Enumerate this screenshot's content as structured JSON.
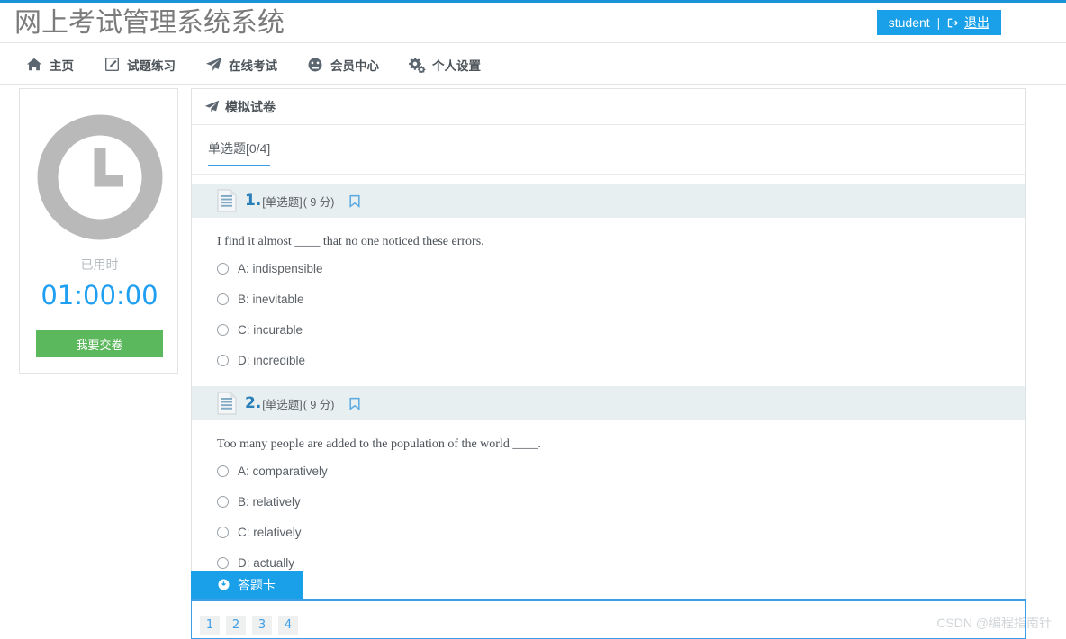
{
  "site": {
    "title": "网上考试管理系统系统",
    "accent_blue": "#19a0e8",
    "accent_green": "#5cb85c",
    "timer_blue": "#1e9ff2"
  },
  "user": {
    "name": "student",
    "separator": "|",
    "logout_label": "退出",
    "logout_icon": "sign-out-icon"
  },
  "nav": {
    "items": [
      {
        "label": "主页",
        "icon": "home-icon"
      },
      {
        "label": "试题练习",
        "icon": "pencil-square-icon"
      },
      {
        "label": "在线考试",
        "icon": "paper-plane-icon"
      },
      {
        "label": "会员中心",
        "icon": "dashboard-gauge-icon"
      },
      {
        "label": "个人设置",
        "icon": "gears-icon"
      }
    ]
  },
  "timer_card": {
    "clock_icon": "clock-icon",
    "elapsed_label": "已用时",
    "time_value": "01:00:00",
    "submit_label": "我要交卷"
  },
  "exam": {
    "panel_icon": "paper-plane-icon",
    "panel_title": "模拟试卷",
    "tabs": [
      {
        "label": "单选题[0/4]",
        "active": true
      }
    ],
    "questions": [
      {
        "icon": "document-lines-icon",
        "number": "1.",
        "type_label": "[单选题]",
        "score_label": "( 9 分)",
        "flag_icon": "bookmark-icon",
        "text": "I find it almost ____ that no one noticed these errors.",
        "options": [
          "A: indispensible",
          "B: inevitable",
          "C: incurable",
          "D: incredible"
        ]
      },
      {
        "icon": "document-lines-icon",
        "number": "2.",
        "type_label": "[单选题]",
        "score_label": "( 9 分)",
        "flag_icon": "bookmark-icon",
        "text": "Too many people are added to the population of the world ____.",
        "options": [
          "A: comparatively",
          "B: relatively",
          "C: relatively",
          "D: actually"
        ]
      }
    ]
  },
  "answer_card": {
    "icon": "arrow-down-circle-icon",
    "tab_label": "答题卡",
    "numbers": [
      "1",
      "2",
      "3",
      "4"
    ]
  },
  "watermark": {
    "text": "CSDN @编程指南针"
  }
}
